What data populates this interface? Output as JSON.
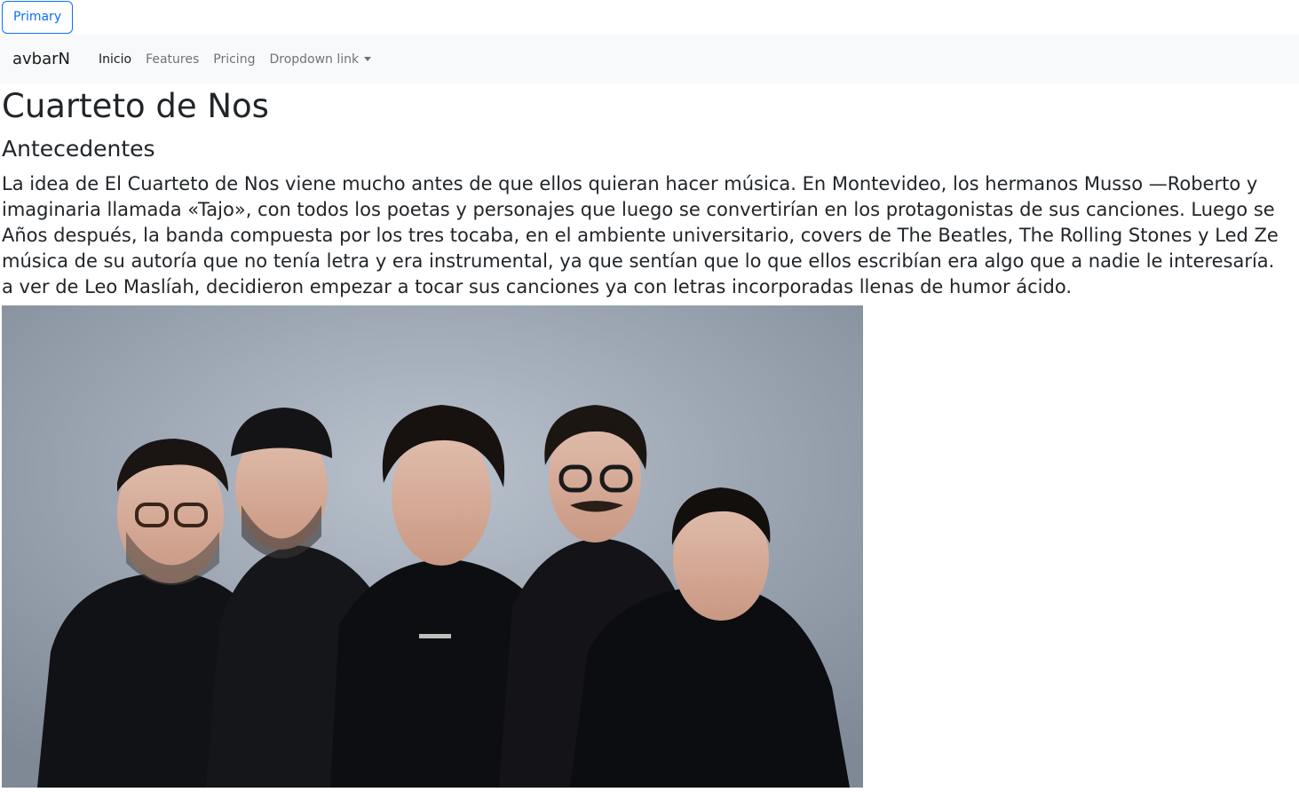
{
  "top_button": {
    "label": "Primary"
  },
  "navbar": {
    "brand": "avbarN",
    "links": [
      {
        "label": "Inicio"
      },
      {
        "label": "Features"
      },
      {
        "label": "Pricing"
      },
      {
        "label": "Dropdown link"
      }
    ]
  },
  "main": {
    "title": "Cuarteto de Nos",
    "subtitle": "Antecedentes",
    "paragraph_lines": [
      "La idea de El Cuarteto de Nos viene mucho antes de que ellos quieran hacer música. En Montevideo, los hermanos Musso —Roberto y",
      "imaginaria llamada «Tajo», con todos los poetas y personajes que luego se convertirían en los protagonistas de sus canciones. Luego se",
      "Años después, la banda compuesta por los tres tocaba, en el ambiente universitario, covers de The Beatles, The Rolling Stones y Led Ze",
      "música de su autoría que no tenía letra y era instrumental, ya que sentían que lo que ellos escribían era algo que a nadie le interesaría.",
      "a ver de Leo Maslíah, decidieron empezar a tocar sus canciones ya con letras incorporadas llenas de humor ácido."
    ]
  },
  "photo": {
    "icon": "band-photo"
  },
  "colors": {
    "primary": "#0d6efd",
    "navbar_bg": "#f8f9fa",
    "text": "#212529"
  }
}
